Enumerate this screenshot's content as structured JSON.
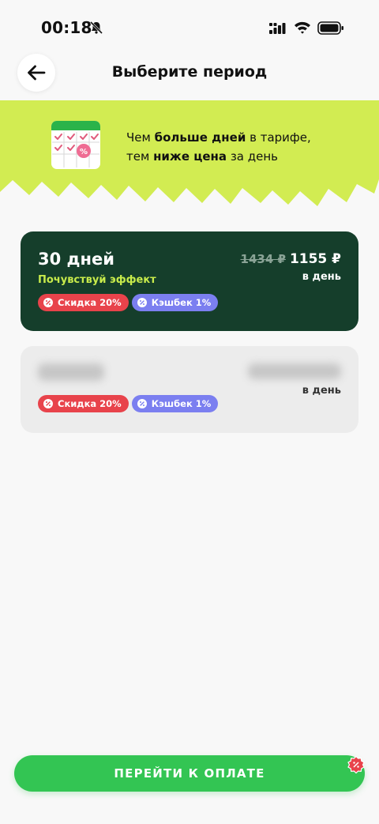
{
  "status_bar": {
    "time": "00:18"
  },
  "header": {
    "title": "Выберите период"
  },
  "banner": {
    "line1_pre": "Чем ",
    "line1_bold": "больше дней",
    "line1_post": " в тарифе,",
    "line2_pre": "тем ",
    "line2_bold": "ниже цена",
    "line2_post": " за день"
  },
  "plans": [
    {
      "title": "30 дней",
      "subtitle": "Почувствуй эффект",
      "old_price": "1434 ₽",
      "price": "1155 ₽",
      "per_day": "в день",
      "badges": [
        "Скидка 20%",
        "Кэшбек 1%"
      ]
    },
    {
      "per_day": "в день",
      "badges": [
        "Скидка 20%",
        "Кэшбек 1%"
      ]
    }
  ],
  "footer": {
    "pay_label": "ПЕРЕЙТИ К ОПЛАТЕ"
  },
  "colors": {
    "accent_green": "#33c553",
    "banner_lime": "#d2ec52",
    "selected_card": "#153e2b",
    "subtitle_lime": "#c8eb4b",
    "discount_red": "#e8434b",
    "cashback_blue": "#7b7ff0"
  }
}
